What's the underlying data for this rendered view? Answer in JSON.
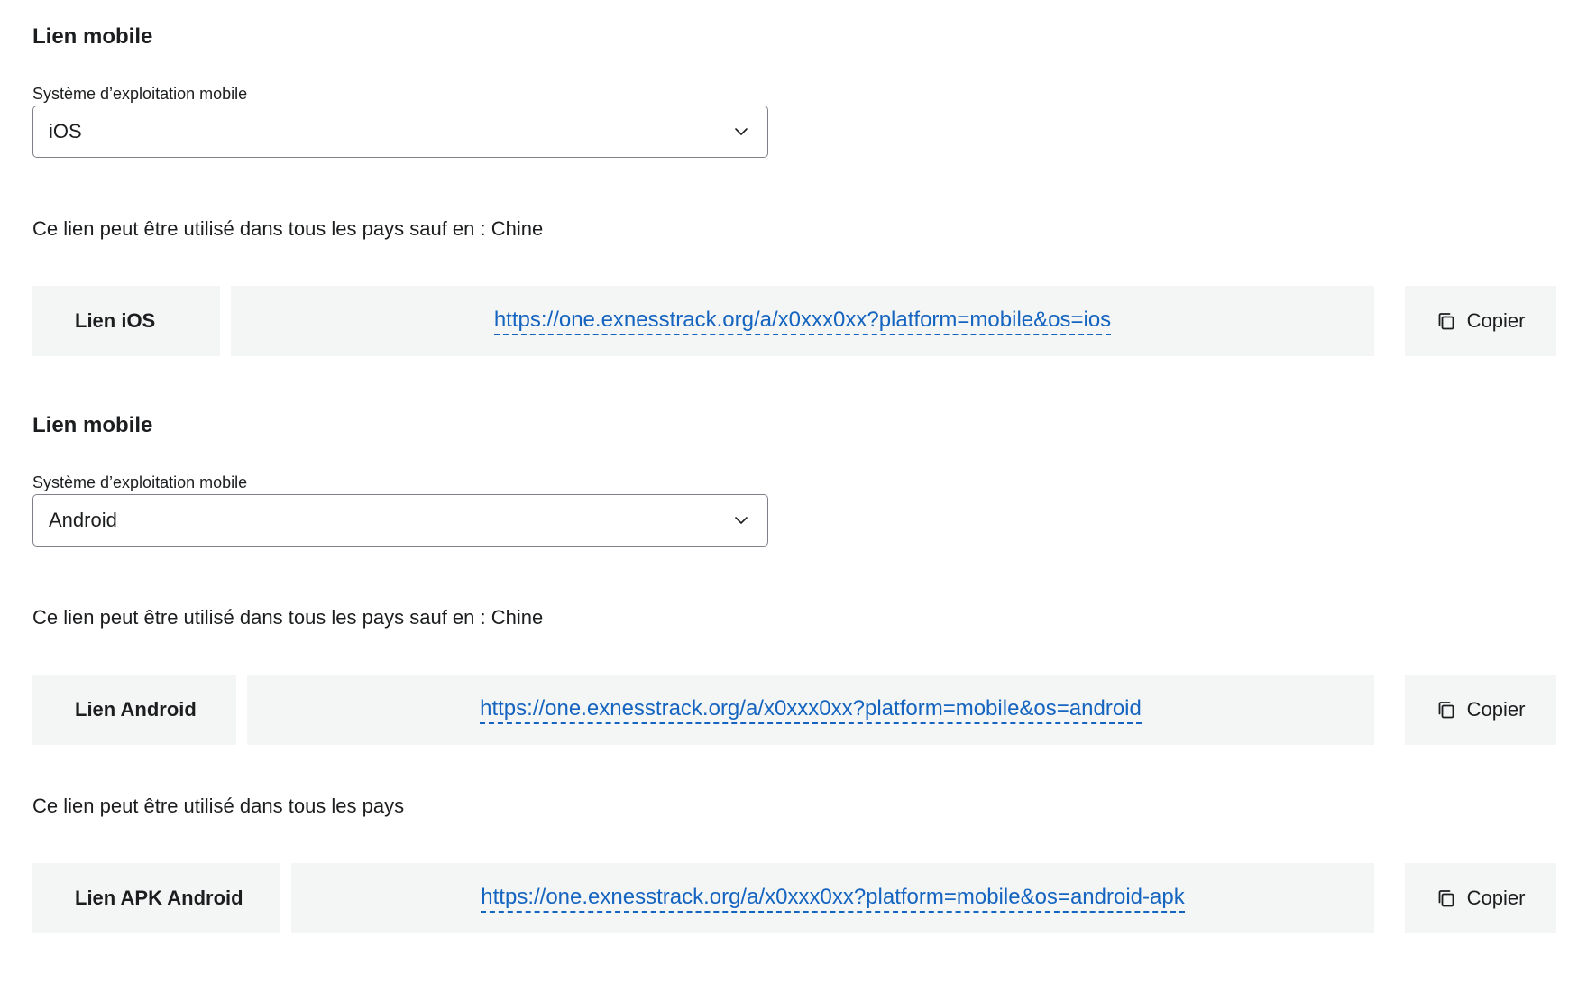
{
  "sections": [
    {
      "title": "Lien mobile",
      "os_label": "Système d’exploitation mobile",
      "os_selected": "iOS",
      "links": [
        {
          "notice": "Ce lien peut être utilisé dans tous les pays sauf en : Chine",
          "label": "Lien iOS",
          "url": "https://one.exnesstrack.org/a/x0xxx0xx?platform=mobile&os=ios",
          "copy_label": "Copier"
        }
      ]
    },
    {
      "title": "Lien mobile",
      "os_label": "Système d’exploitation mobile",
      "os_selected": "Android",
      "links": [
        {
          "notice": "Ce lien peut être utilisé dans tous les pays sauf en : Chine",
          "label": "Lien Android",
          "url": "https://one.exnesstrack.org/a/x0xxx0xx?platform=mobile&os=android",
          "copy_label": "Copier"
        },
        {
          "notice": "Ce lien peut être utilisé dans tous les pays",
          "label": "Lien APK Android",
          "url": "https://one.exnesstrack.org/a/x0xxx0xx?platform=mobile&os=android-apk",
          "copy_label": "Copier"
        }
      ]
    }
  ],
  "icons": {
    "select_arrow": "chevron-down-icon",
    "copy": "copy-icon"
  },
  "colors": {
    "link": "#1565c0",
    "panel_bg": "#f4f5f5",
    "text": "#1b1d1f",
    "border": "#7d8187"
  }
}
